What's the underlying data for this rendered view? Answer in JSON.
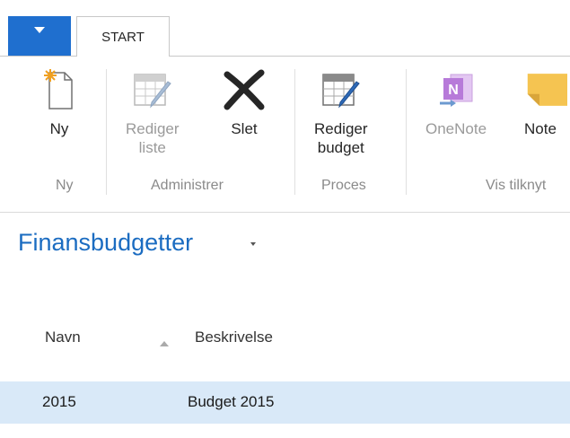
{
  "tabs": [
    {
      "label": "START"
    }
  ],
  "ribbon": {
    "buttons": {
      "new": "Ny",
      "edit_list": "Rediger\nliste",
      "delete": "Slet",
      "edit_budget": "Rediger\nbudget",
      "onenote": "OneNote",
      "notes": "Note"
    },
    "groups": {
      "new": "Ny",
      "manage": "Administrer",
      "process": "Proces",
      "show_attached": "Vis tilknyt"
    }
  },
  "page": {
    "title": "Finansbudgetter"
  },
  "table": {
    "columns": [
      "Navn",
      "Beskrivelse"
    ],
    "rows": [
      {
        "name": "2015",
        "description": "Budget 2015"
      }
    ]
  },
  "colors": {
    "accent": "#1f6fcf",
    "title": "#1b6cc1",
    "selected_row": "#d9e9f8",
    "onenote": "#8a3ec9",
    "note": "#f5c451"
  },
  "icons": [
    "menu-caret-icon",
    "new-document-icon",
    "edit-list-icon",
    "delete-x-icon",
    "edit-budget-icon",
    "onenote-icon",
    "note-icon",
    "sort-ascending-icon"
  ]
}
